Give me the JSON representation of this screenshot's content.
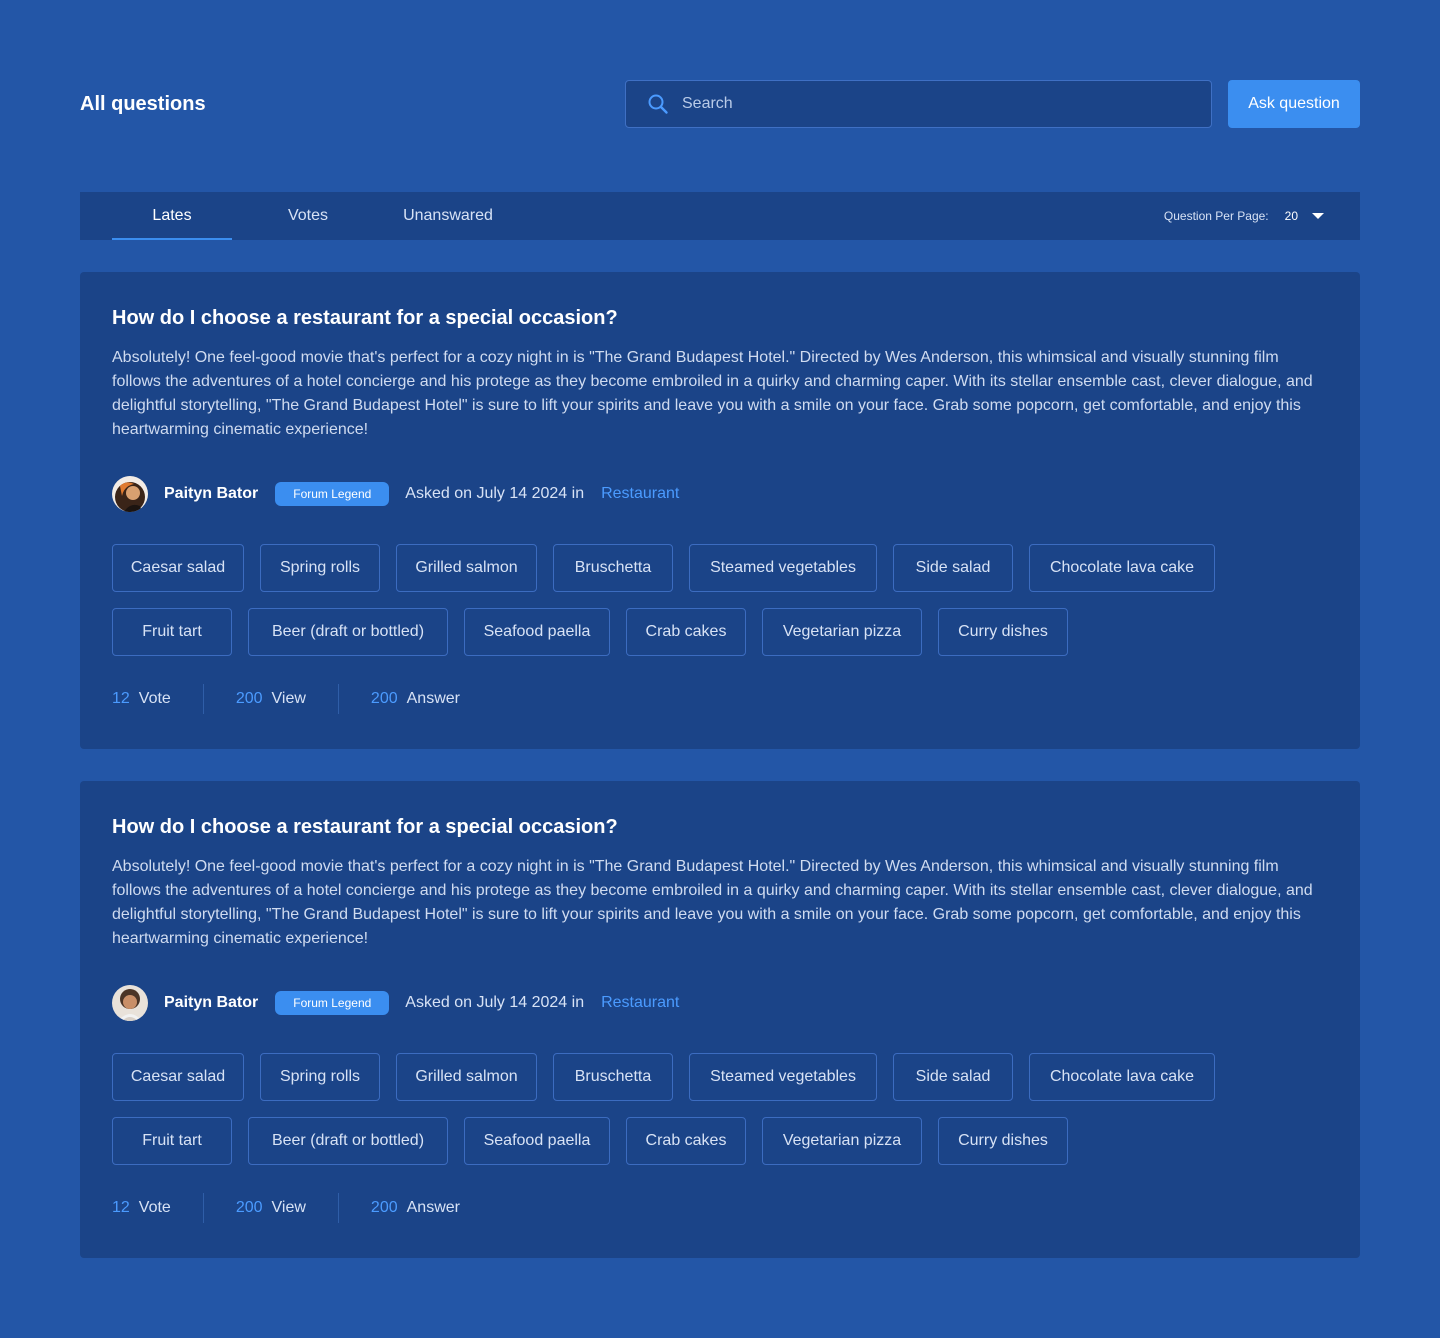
{
  "header": {
    "title": "All questions",
    "search_placeholder": "Search",
    "ask_button": "Ask question"
  },
  "tabs": [
    {
      "label": "Lates",
      "active": true
    },
    {
      "label": "Votes",
      "active": false
    },
    {
      "label": "Unanswared",
      "active": false
    }
  ],
  "per_page": {
    "label": "Question Per Page:",
    "value": "20"
  },
  "colors": {
    "background": "#2356a7",
    "panel": "#1b4488",
    "accent": "#3b8ef0",
    "link": "#4b9bff"
  },
  "questions": [
    {
      "title": "How do I choose a restaurant for a special occasion?",
      "body": "Absolutely! One feel-good movie that's perfect for a cozy night in is \"The Grand Budapest Hotel.\" Directed by Wes Anderson, this whimsical and visually stunning film follows the adventures of a hotel concierge and his protege as they become embroiled in a quirky and charming caper. With its stellar ensemble cast, clever dialogue, and delightful storytelling, \"The Grand Budapest Hotel\" is sure to lift your spirits and leave you with a smile on your face. Grab some popcorn, get comfortable, and enjoy this heartwarming cinematic experience!",
      "author": "Paityn Bator",
      "badge": "Forum Legend",
      "asked": "Asked on July 14 2024 in",
      "category": "Restaurant",
      "tags": [
        "Caesar salad",
        "Spring rolls",
        "Grilled salmon",
        "Bruschetta",
        "Steamed vegetables",
        "Side salad",
        "Chocolate lava cake",
        "Fruit tart",
        "Beer (draft or bottled)",
        "Seafood paella",
        "Crab cakes",
        "Vegetarian pizza",
        "Curry dishes"
      ],
      "stats": {
        "votes": "12",
        "votes_label": "Vote",
        "views": "200",
        "views_label": "View",
        "answers": "200",
        "answers_label": "Answer"
      }
    },
    {
      "title": "How do I choose a restaurant for a special occasion?",
      "body": "Absolutely! One feel-good movie that's perfect for a cozy night in is \"The Grand Budapest Hotel.\" Directed by Wes Anderson, this whimsical and visually stunning film follows the adventures of a hotel concierge and his protege as they become embroiled in a quirky and charming caper. With its stellar ensemble cast, clever dialogue, and delightful storytelling, \"The Grand Budapest Hotel\" is sure to lift your spirits and leave you with a smile on your face. Grab some popcorn, get comfortable, and enjoy this heartwarming cinematic experience!",
      "author": "Paityn Bator",
      "badge": "Forum Legend",
      "asked": "Asked on July 14 2024 in",
      "category": "Restaurant",
      "tags": [
        "Caesar salad",
        "Spring rolls",
        "Grilled salmon",
        "Bruschetta",
        "Steamed vegetables",
        "Side salad",
        "Chocolate lava cake",
        "Fruit tart",
        "Beer (draft or bottled)",
        "Seafood paella",
        "Crab cakes",
        "Vegetarian pizza",
        "Curry dishes"
      ],
      "stats": {
        "votes": "12",
        "votes_label": "Vote",
        "views": "200",
        "views_label": "View",
        "answers": "200",
        "answers_label": "Answer"
      }
    }
  ]
}
